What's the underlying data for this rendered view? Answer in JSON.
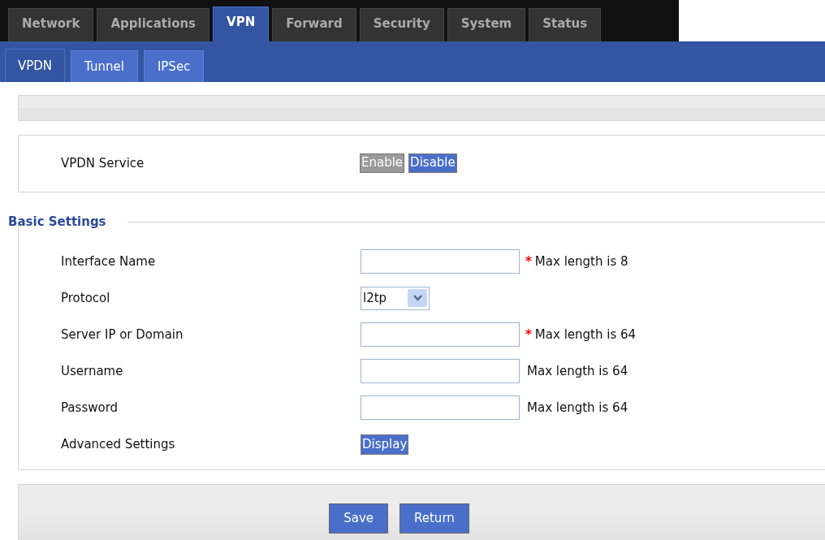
{
  "main_tabs": [
    {
      "label": "Network",
      "selected": false
    },
    {
      "label": "Applications",
      "selected": false
    },
    {
      "label": "VPN",
      "selected": true
    },
    {
      "label": "Forward",
      "selected": false
    },
    {
      "label": "Security",
      "selected": false
    },
    {
      "label": "System",
      "selected": false
    },
    {
      "label": "Status",
      "selected": false
    }
  ],
  "sub_tabs": [
    {
      "label": "VPDN",
      "selected": true
    },
    {
      "label": "Tunnel",
      "selected": false
    },
    {
      "label": "IPSec",
      "selected": false
    }
  ],
  "service": {
    "label": "VPDN Service",
    "options": [
      {
        "label": "Enable",
        "selected": false
      },
      {
        "label": "Disable",
        "selected": true
      }
    ]
  },
  "basic_settings": {
    "title": "Basic Settings",
    "fields": [
      {
        "kind": "text",
        "label": "Interface Name",
        "required_mark": "*",
        "note": "Max length is 8"
      },
      {
        "kind": "select",
        "label": "Protocol",
        "value": "l2tp"
      },
      {
        "kind": "text",
        "label": "Server IP or Domain",
        "required_mark": "*",
        "note": "Max length is 64"
      },
      {
        "kind": "text",
        "label": "Username",
        "note": "Max length is 64"
      },
      {
        "kind": "text",
        "label": "Password",
        "note": "Max length is 64"
      },
      {
        "kind": "button",
        "label": "Advanced Settings",
        "value": "Display"
      }
    ]
  },
  "buttons": [
    "Save",
    "Return"
  ]
}
